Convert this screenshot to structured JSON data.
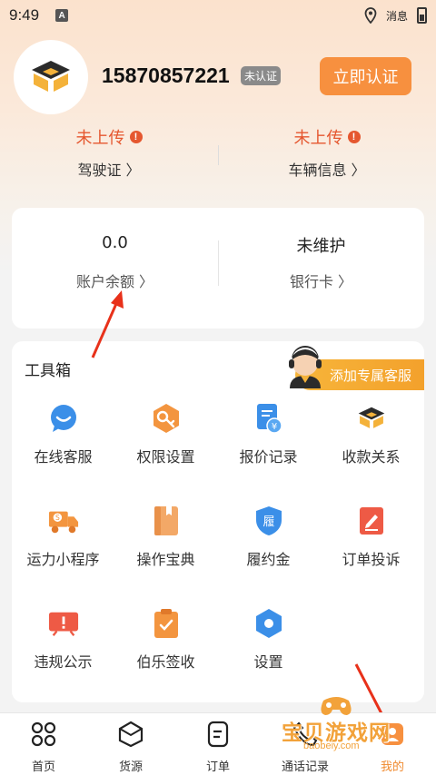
{
  "status_bar": {
    "time": "9:49",
    "notification_label": "A",
    "right_text": "消息"
  },
  "profile": {
    "phone": "15870857221",
    "badge": "未认证",
    "verify_button": "立即认证"
  },
  "documents": [
    {
      "status": "未上传",
      "label": "驾驶证 〉"
    },
    {
      "status": "未上传",
      "label": "车辆信息 〉"
    }
  ],
  "balance": [
    {
      "value": "0.0",
      "label": "账户余额 〉"
    },
    {
      "value": "未维护",
      "label": "银行卡 〉"
    }
  ],
  "toolbox": {
    "title": "工具箱",
    "cs_banner": "添加专属客服",
    "tools": [
      {
        "label": "在线客服",
        "icon": "chat-bubble-icon"
      },
      {
        "label": "权限设置",
        "icon": "key-icon"
      },
      {
        "label": "报价记录",
        "icon": "quote-record-icon"
      },
      {
        "label": "收款关系",
        "icon": "logo-icon"
      },
      {
        "label": "运力小程序",
        "icon": "truck-icon"
      },
      {
        "label": "操作宝典",
        "icon": "book-icon"
      },
      {
        "label": "履约金",
        "icon": "shield-icon"
      },
      {
        "label": "订单投诉",
        "icon": "edit-icon"
      },
      {
        "label": "违规公示",
        "icon": "alert-board-icon"
      },
      {
        "label": "伯乐签收",
        "icon": "clipboard-check-icon"
      },
      {
        "label": "设置",
        "icon": "gear-icon"
      }
    ]
  },
  "nav": [
    {
      "label": "首页"
    },
    {
      "label": "货源"
    },
    {
      "label": "订单"
    },
    {
      "label": "通话记录"
    },
    {
      "label": "我的"
    }
  ],
  "watermark": {
    "text": "宝贝游戏网",
    "url": "baobeiy.com"
  },
  "colors": {
    "accent": "#f7903f",
    "warning": "#e5572f",
    "tool_orange": "#f3953f",
    "tool_blue": "#3b8fe8",
    "tool_red": "#ee5a45"
  }
}
